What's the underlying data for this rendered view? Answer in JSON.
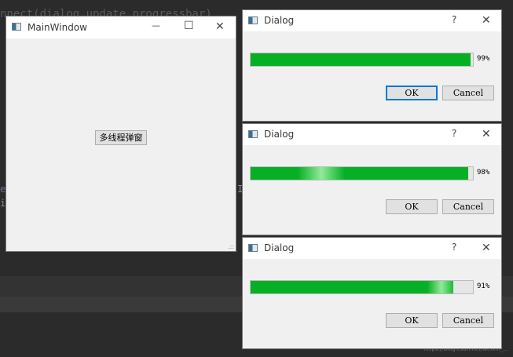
{
  "background": {
    "code_line": "nnect(dialog.update_progressbar)",
    "fragment_left_1": "e",
    "fragment_left_2": "i",
    "fragment_mid": "I",
    "watermark": "https://blog.csdn.net/weixin_..."
  },
  "main_window": {
    "title": "MainWindow",
    "minimize_glyph": "—",
    "maximize_glyph": "☐",
    "close_glyph": "✕",
    "button_label": "多线程弹窗",
    "grip_glyph": ".::"
  },
  "dialogs": [
    {
      "title": "Dialog",
      "help_glyph": "?",
      "close_glyph": "✕",
      "progress": 0.99,
      "percent_label": "99%",
      "ok_label": "OK",
      "cancel_label": "Cancel"
    },
    {
      "title": "Dialog",
      "help_glyph": "?",
      "close_glyph": "✕",
      "progress": 0.98,
      "percent_label": "98%",
      "ok_label": "OK",
      "cancel_label": "Cancel"
    },
    {
      "title": "Dialog",
      "help_glyph": "?",
      "close_glyph": "✕",
      "progress": 0.91,
      "percent_label": "91%",
      "ok_label": "OK",
      "cancel_label": "Cancel"
    }
  ],
  "colors": {
    "progress_fill": "#06b025",
    "focus_border": "#0078d7",
    "editor_background": "#2b2b2b"
  }
}
